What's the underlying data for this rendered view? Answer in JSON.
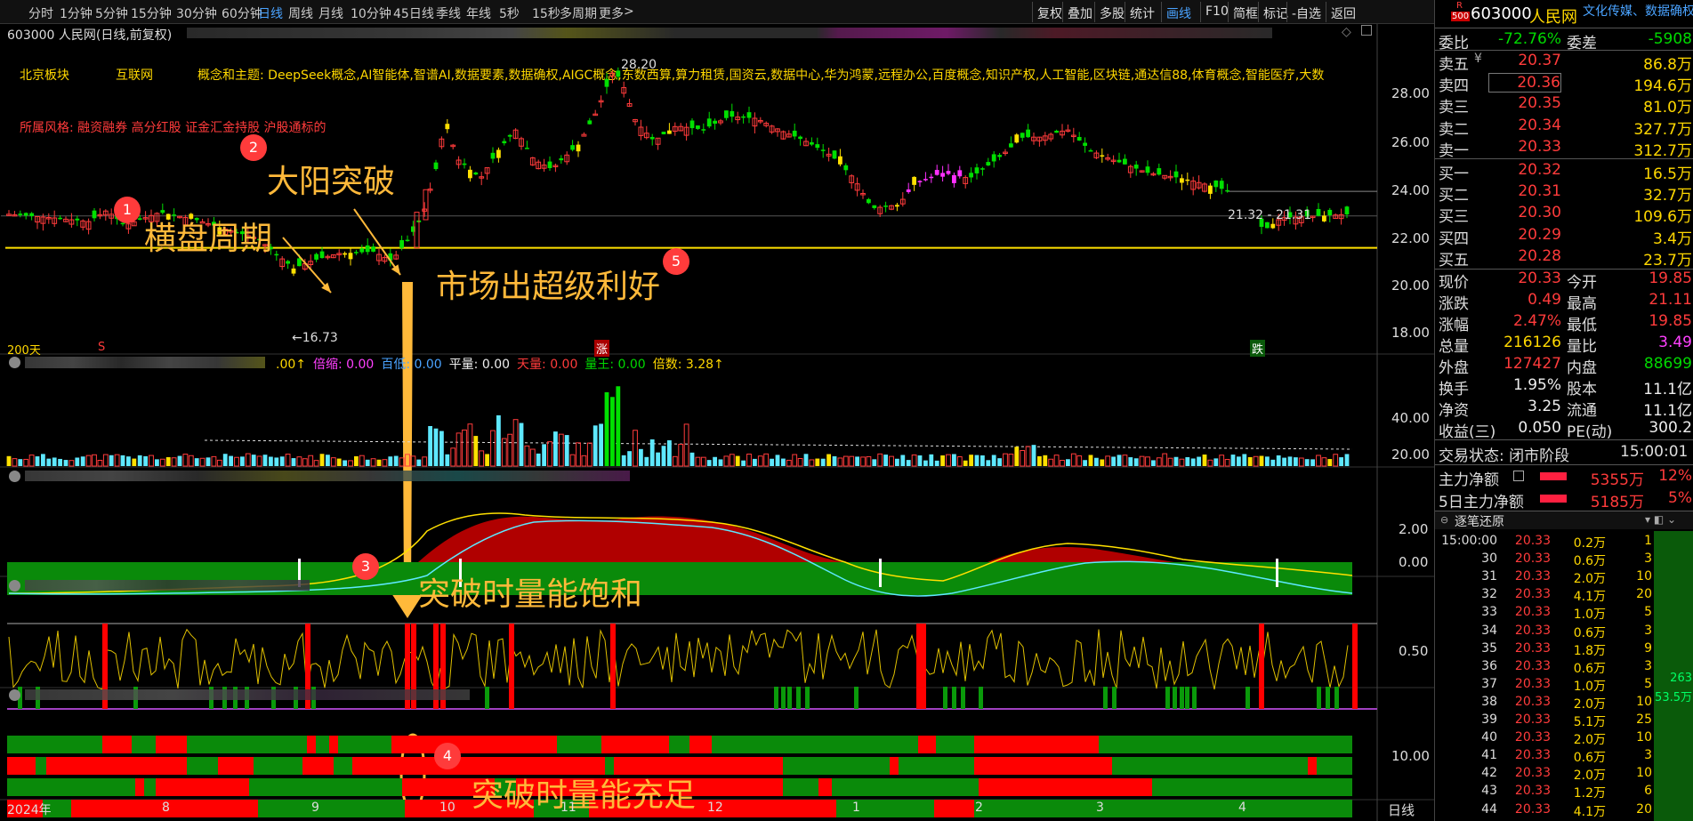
{
  "toolbar": {
    "timeframes": [
      "分时",
      "1分钟",
      "5分钟",
      "15分钟",
      "30分钟",
      "60分钟",
      "日线",
      "周线",
      "月线",
      "10分钟",
      "45日线",
      "季线",
      "年线",
      "5秒",
      "15秒",
      "多周期",
      "更多"
    ],
    "active": "日线",
    "more_arrow": ">",
    "right_buttons": [
      "复权",
      "叠加",
      "多股",
      "统计",
      "画线",
      "F10",
      "简框",
      "标记",
      "-自选",
      "返回"
    ],
    "active_right": "画线"
  },
  "chart_header": {
    "title": "603000 人民网(日线,前复权)",
    "board": "北京板块",
    "industry": "互联网",
    "concepts": "概念和主题: DeepSeek概念,AI智能体,智谱AI,数据要素,数据确权,AIGC概念,东数西算,算力租赁,国资云,数据中心,华为鸿蒙,远程办公,百度概念,知识产权,人工智能,区块链,通达信88,体育概念,智能医疗,大数",
    "style": "所属风格: 融资融券 高分红股 证金汇金持股 沪股通标的"
  },
  "price_chart": {
    "high_label": "28.20",
    "low_label": "←16.73",
    "range_label": "21.32 - 21.31",
    "ma_label": "200天",
    "axis_ticks": [
      "28.00",
      "26.00",
      "24.00",
      "22.00",
      "20.00",
      "18.00"
    ],
    "badges": {
      "s": "S",
      "zhang": "涨",
      "die": "跌"
    }
  },
  "volume_panel": {
    "params": [
      {
        "label": ".00↑",
        "color": "#ffd800"
      },
      {
        "label": "倍缩: 0.00",
        "color": "#ff40ff"
      },
      {
        "label": "百低: 0.00",
        "color": "#4aa3ff"
      },
      {
        "label": "平量: 0.00",
        "color": "#eeeeee"
      },
      {
        "label": "天量: 0.00",
        "color": "#ff3b3b"
      },
      {
        "label": "量王: 0.00",
        "color": "#00d800"
      },
      {
        "label": "倍数: 3.28↑",
        "color": "#ffd800"
      }
    ],
    "axis_ticks": [
      "40.00",
      "20.00"
    ]
  },
  "macd_panel": {
    "axis_ticks": [
      "2.00",
      "0.00"
    ]
  },
  "energy_panel": {
    "axis_ticks": [
      "0.50"
    ]
  },
  "bars_panel": {
    "axis_ticks": [
      "10.00"
    ]
  },
  "x_axis": {
    "labels": [
      "2024年",
      "8",
      "9",
      "10",
      "11",
      "12",
      "1",
      "2",
      "3",
      "4"
    ],
    "right_label": "日线"
  },
  "annotations": {
    "n1": "1",
    "t1": "横盘周期",
    "n2": "2",
    "t2": "大阳突破",
    "n3": "3",
    "t3": "突破时量能饱和",
    "n4": "4",
    "t4": "突破时量能充足",
    "n5": "5",
    "t5": "市场出超级利好"
  },
  "quote": {
    "r_badge": "R",
    "code_badge": "500",
    "code": "603000",
    "name": "人民网",
    "tags": "文化传媒、数据确权",
    "weibi_label": "委比",
    "weibi": "-72.76%",
    "weicha_label": "委差",
    "weicha": "-5908",
    "sell": [
      {
        "label": "卖五",
        "marker": "¥",
        "price": "20.37",
        "vol": "86.8万"
      },
      {
        "label": "卖四",
        "marker": "",
        "price": "20.36",
        "vol": "194.6万"
      },
      {
        "label": "卖三",
        "marker": "",
        "price": "20.35",
        "vol": "81.0万"
      },
      {
        "label": "卖二",
        "marker": "",
        "price": "20.34",
        "vol": "327.7万"
      },
      {
        "label": "卖一",
        "marker": "",
        "price": "20.33",
        "vol": "312.7万"
      }
    ],
    "buy": [
      {
        "label": "买一",
        "price": "20.32",
        "vol": "16.5万"
      },
      {
        "label": "买二",
        "price": "20.31",
        "vol": "32.7万"
      },
      {
        "label": "买三",
        "price": "20.30",
        "vol": "109.6万"
      },
      {
        "label": "买四",
        "price": "20.29",
        "vol": "3.4万"
      },
      {
        "label": "买五",
        "price": "20.28",
        "vol": "23.7万"
      }
    ],
    "stats": [
      {
        "l1": "现价",
        "v1": "20.33",
        "c1": "red",
        "l2": "今开",
        "v2": "19.85",
        "c2": "red"
      },
      {
        "l1": "涨跌",
        "v1": "0.49",
        "c1": "red",
        "l2": "最高",
        "v2": "21.11",
        "c2": "red"
      },
      {
        "l1": "涨幅",
        "v1": "2.47%",
        "c1": "red",
        "l2": "最低",
        "v2": "19.85",
        "c2": "red"
      },
      {
        "l1": "总量",
        "v1": "216126",
        "c1": "yellow",
        "l2": "量比",
        "v2": "3.49",
        "c2": "magenta"
      },
      {
        "l1": "外盘",
        "v1": "127427",
        "c1": "red",
        "l2": "内盘",
        "v2": "88699",
        "c2": "green"
      },
      {
        "l1": "换手",
        "v1": "1.95%",
        "c1": "white",
        "l2": "股本",
        "v2": "11.1亿",
        "c2": "white"
      },
      {
        "l1": "净资",
        "v1": "3.25",
        "c1": "white",
        "l2": "流通",
        "v2": "11.1亿",
        "c2": "white"
      },
      {
        "l1": "收益(三)",
        "v1": "0.050",
        "c1": "white",
        "l2": "PE(动)",
        "v2": "300.2",
        "c2": "white"
      }
    ],
    "status_label": "交易状态: 闭市阶段",
    "status_time": "15:00:01",
    "flow": [
      {
        "label": "主力净额",
        "val": "5355万",
        "pct": "12%"
      },
      {
        "label": "5日主力净额",
        "val": "5185万",
        "pct": "5%"
      }
    ],
    "ticks_title": "逐笔还原",
    "ticks_side_top": "263",
    "ticks_side_bottom": "53.5万",
    "ticks": [
      {
        "t": "15:00:00",
        "p": "20.33",
        "v": "0.2万",
        "n": "1"
      },
      {
        "t": "30",
        "p": "20.33",
        "v": "0.6万",
        "n": "3"
      },
      {
        "t": "31",
        "p": "20.33",
        "v": "2.0万",
        "n": "10"
      },
      {
        "t": "32",
        "p": "20.33",
        "v": "4.1万",
        "n": "20"
      },
      {
        "t": "33",
        "p": "20.33",
        "v": "1.0万",
        "n": "5"
      },
      {
        "t": "34",
        "p": "20.33",
        "v": "0.6万",
        "n": "3"
      },
      {
        "t": "35",
        "p": "20.33",
        "v": "1.8万",
        "n": "9"
      },
      {
        "t": "36",
        "p": "20.33",
        "v": "0.6万",
        "n": "3"
      },
      {
        "t": "37",
        "p": "20.33",
        "v": "1.0万",
        "n": "5"
      },
      {
        "t": "38",
        "p": "20.33",
        "v": "2.0万",
        "n": "10"
      },
      {
        "t": "39",
        "p": "20.33",
        "v": "5.1万",
        "n": "25"
      },
      {
        "t": "40",
        "p": "20.33",
        "v": "2.0万",
        "n": "10"
      },
      {
        "t": "41",
        "p": "20.33",
        "v": "0.6万",
        "n": "3"
      },
      {
        "t": "42",
        "p": "20.33",
        "v": "2.0万",
        "n": "10"
      },
      {
        "t": "43",
        "p": "20.33",
        "v": "1.2万",
        "n": "6"
      },
      {
        "t": "44",
        "p": "20.33",
        "v": "4.1万",
        "n": "20"
      }
    ]
  }
}
